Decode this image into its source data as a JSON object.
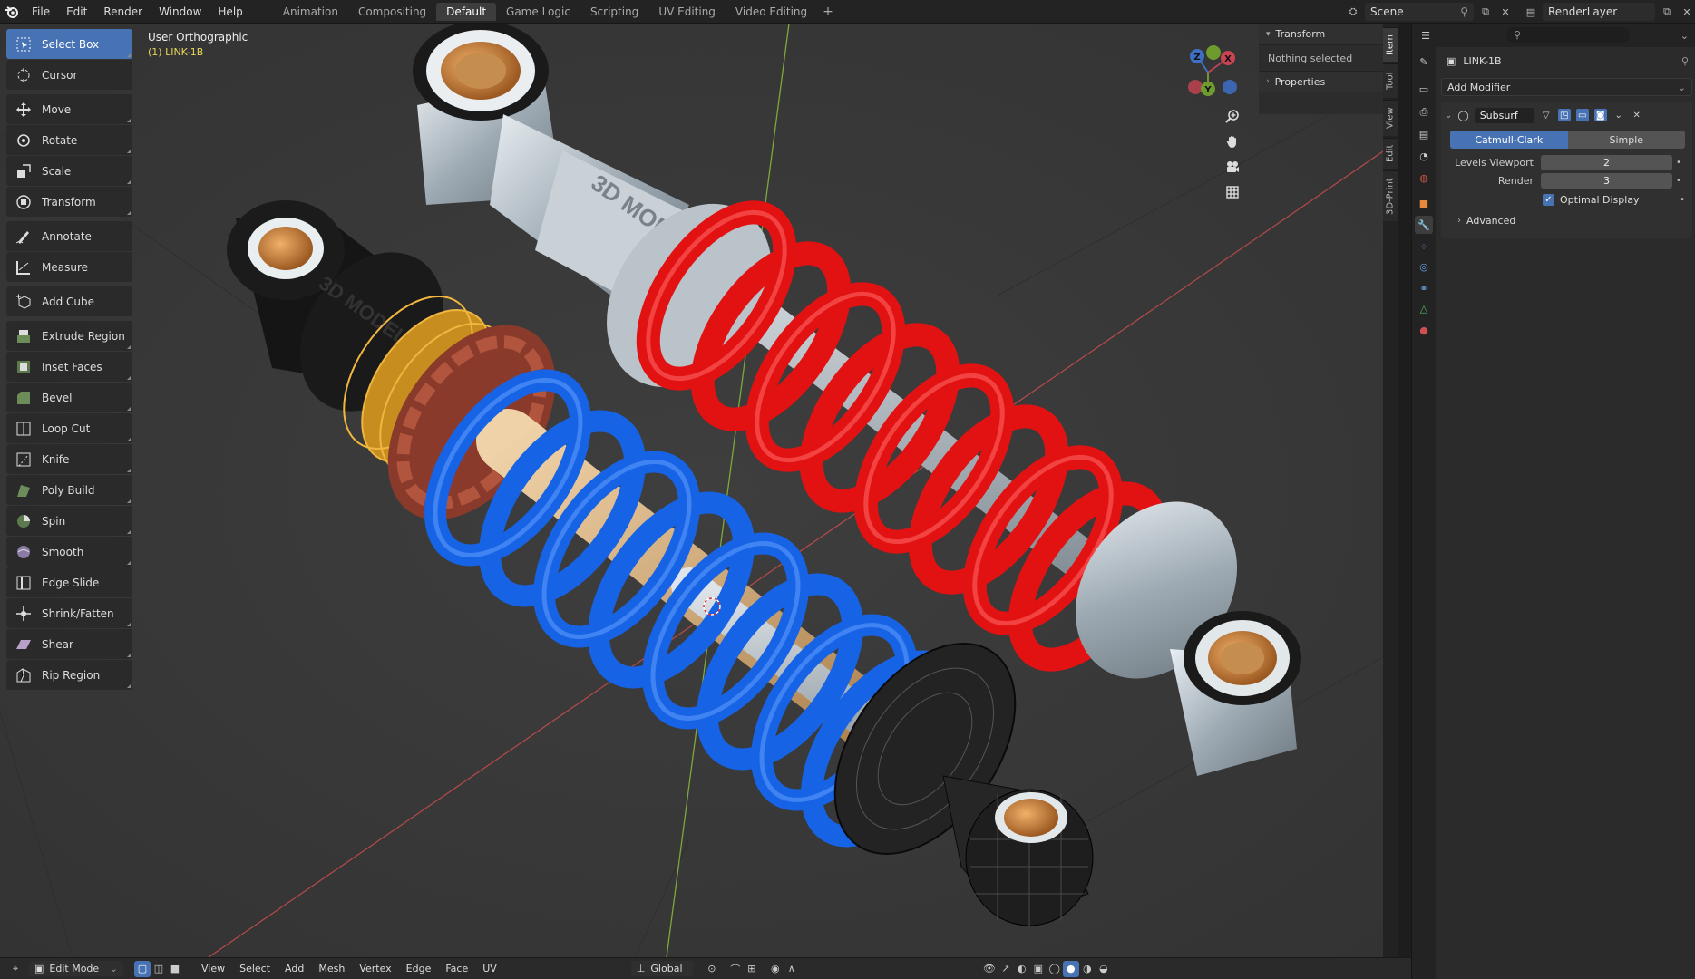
{
  "topbar": {
    "menus": [
      "File",
      "Edit",
      "Render",
      "Window",
      "Help"
    ],
    "workspaces": [
      "Animation",
      "Compositing",
      "Default",
      "Game Logic",
      "Scripting",
      "UV Editing",
      "Video Editing"
    ],
    "active_workspace": "Default",
    "scene": "Scene",
    "view_layer": "RenderLayer"
  },
  "toolbar": {
    "tools": [
      {
        "label": "Select Box",
        "icon": "select-box-icon",
        "active": true
      },
      {
        "label": "Cursor",
        "icon": "cursor-icon"
      },
      {
        "label": "Move",
        "icon": "move-icon"
      },
      {
        "label": "Rotate",
        "icon": "rotate-icon"
      },
      {
        "label": "Scale",
        "icon": "scale-icon"
      },
      {
        "label": "Transform",
        "icon": "transform-icon"
      },
      {
        "label": "Annotate",
        "icon": "annotate-icon"
      },
      {
        "label": "Measure",
        "icon": "measure-icon"
      },
      {
        "label": "Add Cube",
        "icon": "add-cube-icon"
      },
      {
        "label": "Extrude Region",
        "icon": "extrude-icon"
      },
      {
        "label": "Inset Faces",
        "icon": "inset-icon"
      },
      {
        "label": "Bevel",
        "icon": "bevel-icon"
      },
      {
        "label": "Loop Cut",
        "icon": "loop-cut-icon"
      },
      {
        "label": "Knife",
        "icon": "knife-icon"
      },
      {
        "label": "Poly Build",
        "icon": "poly-build-icon"
      },
      {
        "label": "Spin",
        "icon": "spin-icon"
      },
      {
        "label": "Smooth",
        "icon": "smooth-icon"
      },
      {
        "label": "Edge Slide",
        "icon": "edge-slide-icon"
      },
      {
        "label": "Shrink/Fatten",
        "icon": "shrink-fatten-icon"
      },
      {
        "label": "Shear",
        "icon": "shear-icon"
      },
      {
        "label": "Rip Region",
        "icon": "rip-region-icon"
      }
    ]
  },
  "viewport": {
    "view_name": "User Orthographic",
    "object_label": "(1) LINK-1B",
    "gizmo_axes": [
      "X",
      "Y",
      "Z"
    ]
  },
  "npanel": {
    "transform_header": "Transform",
    "transform_body": "Nothing selected",
    "properties_header": "Properties",
    "tabs": [
      "Item",
      "Tool",
      "View",
      "Edit",
      "3D-Print"
    ]
  },
  "header": {
    "mode": "Edit Mode",
    "menus": [
      "View",
      "Select",
      "Add",
      "Mesh",
      "Vertex",
      "Edge",
      "Face",
      "UV"
    ],
    "orientation": "Global"
  },
  "properties": {
    "object_name": "LINK-1B",
    "add_modifier": "Add Modifier",
    "modifier": {
      "name": "Subsurf",
      "mode_options": [
        "Catmull-Clark",
        "Simple"
      ],
      "active_mode": "Catmull-Clark",
      "levels_viewport_label": "Levels Viewport",
      "levels_viewport": "2",
      "render_label": "Render",
      "render": "3",
      "optimal_display_label": "Optimal Display",
      "optimal_display": true,
      "advanced_label": "Advanced"
    }
  },
  "colors": {
    "accent": "#4772b3",
    "spring_red": "#e01010",
    "spring_blue": "#1560e0",
    "bushing": "#c98a40"
  }
}
